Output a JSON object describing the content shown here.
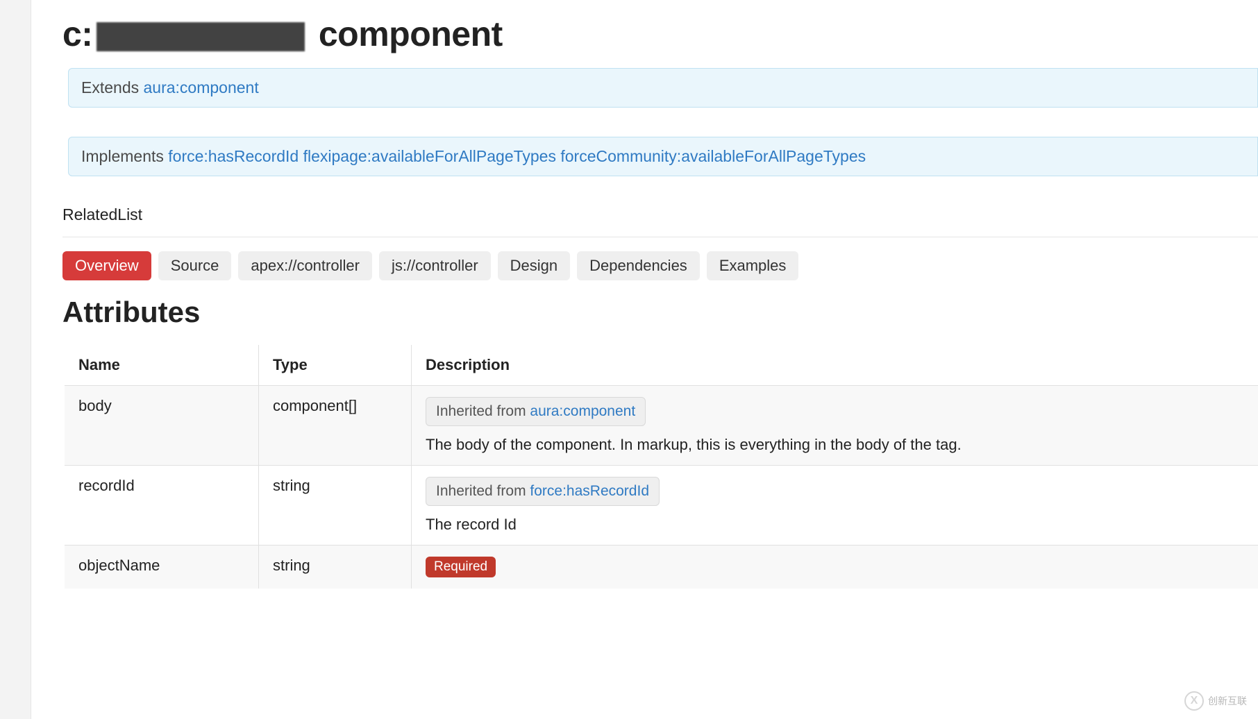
{
  "header": {
    "title_prefix": "c:",
    "title_suffix": " component"
  },
  "extends_box": {
    "label": "Extends ",
    "link": "aura:component"
  },
  "implements_box": {
    "label": "Implements ",
    "links": [
      "force:hasRecordId",
      "flexipage:availableForAllPageTypes",
      "forceCommunity:availableForAllPageTypes"
    ]
  },
  "sub_label": "RelatedList",
  "tabs": [
    {
      "label": "Overview",
      "active": true
    },
    {
      "label": "Source",
      "active": false
    },
    {
      "label": "apex://controller",
      "active": false
    },
    {
      "label": "js://controller",
      "active": false
    },
    {
      "label": "Design",
      "active": false
    },
    {
      "label": "Dependencies",
      "active": false
    },
    {
      "label": "Examples",
      "active": false
    }
  ],
  "section_title": "Attributes",
  "table": {
    "headers": [
      "Name",
      "Type",
      "Description"
    ],
    "rows": [
      {
        "name": "body",
        "type": "component[]",
        "inherited_label": "Inherited from ",
        "inherited_link": "aura:component",
        "description": "The body of the component. In markup, this is everything in the body of the tag."
      },
      {
        "name": "recordId",
        "type": "string",
        "inherited_label": "Inherited from ",
        "inherited_link": "force:hasRecordId",
        "description": "The record Id"
      },
      {
        "name": "objectName",
        "type": "string",
        "required_label": "Required",
        "description": ""
      }
    ]
  },
  "watermark": "创新互联"
}
